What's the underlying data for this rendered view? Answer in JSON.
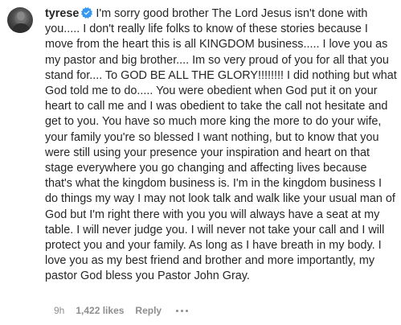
{
  "comment": {
    "avatar_icon": "profile-avatar",
    "username": "tyrese",
    "verified_icon": "verified-badge-icon",
    "verified_color": "#3897f0",
    "text": "I'm sorry good brother The Lord Jesus isn't done with you..... I don't really life folks to know of these stories because I move from the heart this is all KINGDOM business..... I love you as my pastor and big brother.... Im so very proud of you for all that you stand for.... To GOD BE ALL THE GLORY!!!!!!!! I did nothing but what God told me to do..... You were obedient when God put it on your heart to call me and I was obedient to take the call not hesitate and get to you. You have so much more king the more to do your wife, your family you're so blessed I want nothing, but to know that you were still using your presence your inspiration and heart on that stage everywhere you go changing and affecting lives because that's what the kingdom business is. I'm in the kingdom business I do things my way I may not look talk and walk like your usual man of God but I'm right there with you you will always have a seat at my table. I will never judge you. I will never not take your call and I will protect you and your family. As long as I have breath in my body. I love you as my best friend and brother and more importantly, my pastor God bless you Pastor John Gray."
  },
  "footer": {
    "time": "9h",
    "likes": "1,422 likes",
    "reply": "Reply",
    "more_icon": "more-options-icon"
  }
}
